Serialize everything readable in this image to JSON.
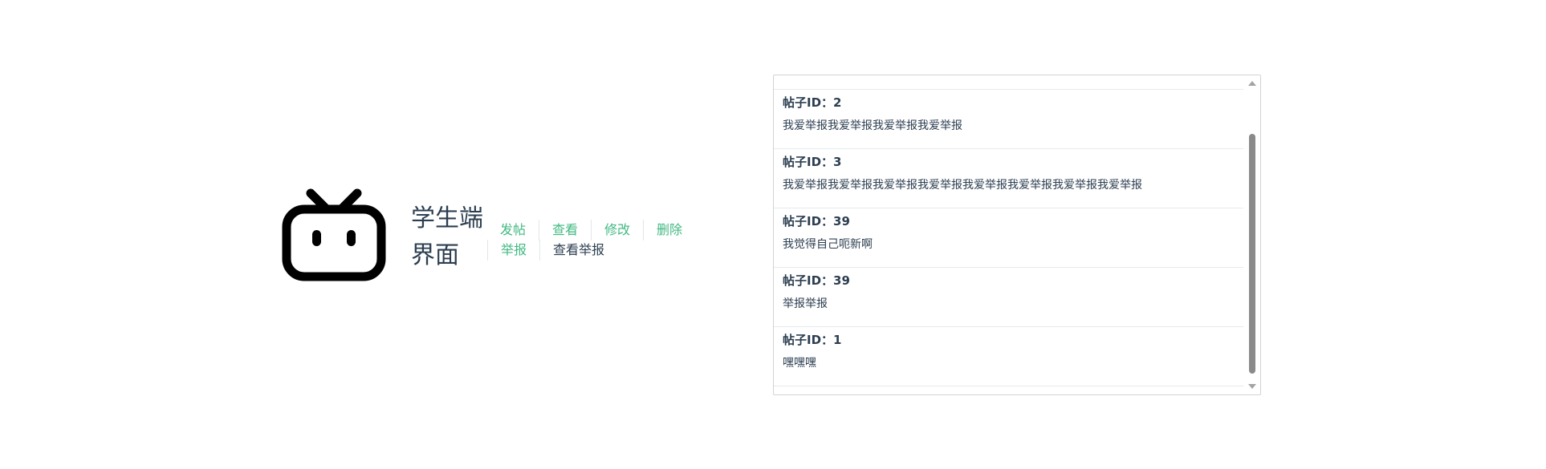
{
  "header": {
    "logo_icon": "bilibili-tv-icon",
    "title": "学生端界面",
    "nav_row1": [
      "发帖",
      "查看",
      "修改",
      "删除"
    ],
    "nav_row2": [
      "举报",
      "查看举报"
    ]
  },
  "posts": [
    {
      "label": "帖子ID：2",
      "content": "我爱举报我爱举报我爱举报我爱举报"
    },
    {
      "label": "帖子ID：3",
      "content": "我爱举报我爱举报我爱举报我爱举报我爱举报我爱举报我爱举报我爱举报"
    },
    {
      "label": "帖子ID：39",
      "content": "我觉得自己呃新啊"
    },
    {
      "label": "帖子ID：39",
      "content": "举报举报"
    },
    {
      "label": "帖子ID：1",
      "content": "嘿嘿嘿"
    }
  ],
  "scroll": {
    "up_icon": "scroll-up-arrow-icon",
    "down_icon": "scroll-down-arrow-icon"
  },
  "colors": {
    "link": "#42b983",
    "text": "#2c3e50",
    "thumb": "#8a8a8a"
  }
}
